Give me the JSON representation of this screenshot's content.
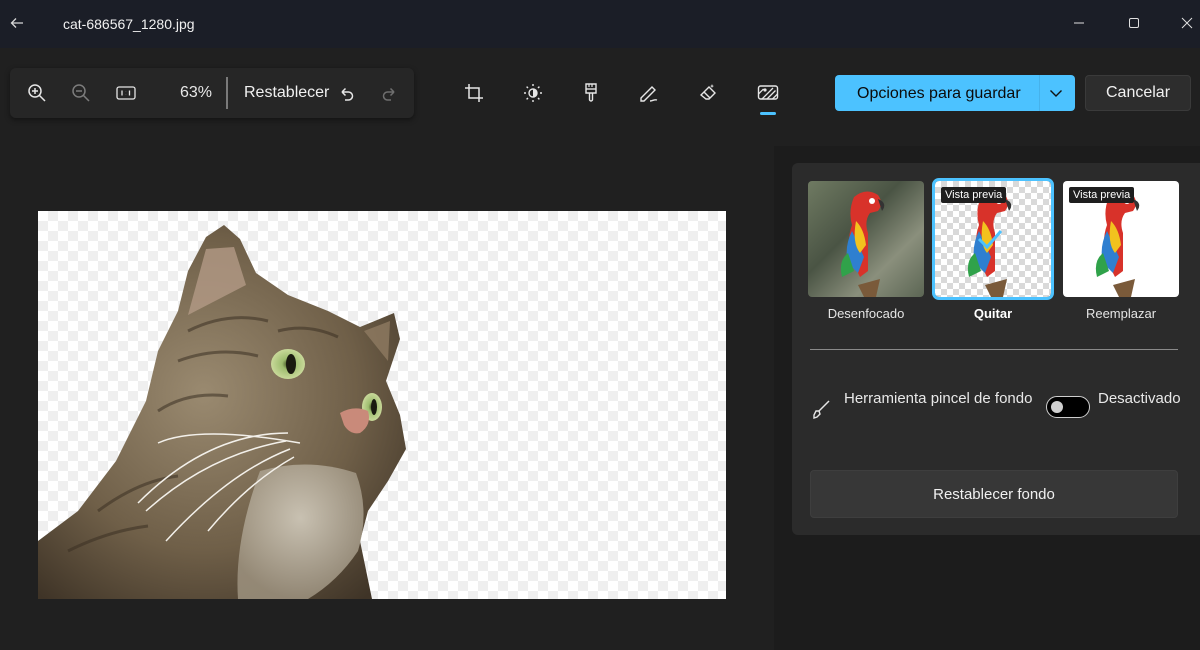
{
  "window": {
    "title": "cat-686567_1280.jpg",
    "icons": {
      "back": "arrow-left-icon",
      "minimize": "minimize-icon",
      "maximize": "maximize-icon",
      "close": "close-icon"
    }
  },
  "toolbar": {
    "zoom_level": "63%",
    "reset_label": "Restablecer",
    "icons": {
      "zoom_in": "zoom-in-icon",
      "zoom_out": "zoom-out-icon",
      "actual_size": "actual-size-icon",
      "undo": "undo-icon",
      "redo": "redo-icon"
    },
    "tools": [
      {
        "name": "crop-icon"
      },
      {
        "name": "brightness-icon"
      },
      {
        "name": "filter-icon"
      },
      {
        "name": "markup-pen-icon"
      },
      {
        "name": "erase-icon"
      },
      {
        "name": "background-icon",
        "active": true
      }
    ],
    "save_label": "Opciones para guardar",
    "cancel_label": "Cancelar"
  },
  "canvas": {
    "image": "cat-with-removed-background",
    "background": "transparent-checkerboard"
  },
  "panel": {
    "options": [
      {
        "label": "Desenfocado",
        "badge": "",
        "selected": false
      },
      {
        "label": "Quitar",
        "badge": "Vista previa",
        "selected": true
      },
      {
        "label": "Reemplazar",
        "badge": "Vista previa",
        "selected": false
      }
    ],
    "brush_tool_label": "Herramienta pincel de fondo",
    "toggle_label": "Desactivado",
    "toggle_on": false,
    "reset_background_label": "Restablecer fondo"
  },
  "colors": {
    "accent": "#4cc2ff",
    "background": "#202020",
    "titlebar": "#1b1e27",
    "panel": "#2b2b2b"
  }
}
